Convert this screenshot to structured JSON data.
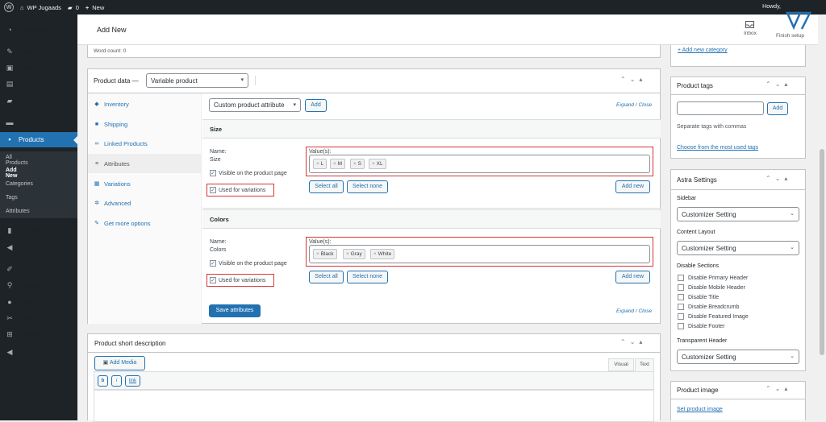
{
  "adminbar": {
    "site_name": "WP Jugaads",
    "comments_count": "0",
    "new_label": "New",
    "howdy": "Howdy,"
  },
  "sidebar": {
    "items": [
      {
        "label": "Dashboard",
        "icon": "dashboard-icon",
        "glyph": "◔"
      },
      {
        "label": "Posts",
        "icon": "pin-icon",
        "glyph": "✎"
      },
      {
        "label": "Media",
        "icon": "media-icon",
        "glyph": "▣"
      },
      {
        "label": "Pages",
        "icon": "pages-icon",
        "glyph": "▤"
      },
      {
        "label": "Comments",
        "icon": "comments-icon",
        "glyph": "▰"
      },
      {
        "label": "WooCommerce",
        "icon": "woo-icon",
        "glyph": "▬"
      },
      {
        "label": "Products",
        "icon": "products-icon",
        "glyph": "▪"
      },
      {
        "label": "Analytics",
        "icon": "analytics-icon",
        "glyph": "▮"
      },
      {
        "label": "Marketing",
        "icon": "marketing-icon",
        "glyph": "◀"
      },
      {
        "label": "Appearance",
        "icon": "brush-icon",
        "glyph": "✐"
      },
      {
        "label": "Plugins",
        "icon": "plugin-icon",
        "glyph": "⚲"
      },
      {
        "label": "Users",
        "icon": "users-icon",
        "glyph": "●"
      },
      {
        "label": "Tools",
        "icon": "wrench-icon",
        "glyph": "✂"
      },
      {
        "label": "Settings",
        "icon": "settings-icon",
        "glyph": "⊞"
      },
      {
        "label": "Collapse menu",
        "icon": "collapse-icon",
        "glyph": "◀"
      }
    ],
    "submenu": [
      "All Products",
      "Add New",
      "Categories",
      "Tags",
      "Attributes"
    ]
  },
  "header": {
    "title": "Add New",
    "inbox": "Inbox",
    "finish_setup": "Finish setup"
  },
  "editor": {
    "word_count": "Word count: 0"
  },
  "product_data": {
    "title": "Product data —",
    "type": "Variable product",
    "tabs": [
      {
        "label": "Inventory",
        "icon": "inventory-icon",
        "glyph": "◆"
      },
      {
        "label": "Shipping",
        "icon": "truck-icon",
        "glyph": "■"
      },
      {
        "label": "Linked Products",
        "icon": "link-icon",
        "glyph": "∞"
      },
      {
        "label": "Attributes",
        "icon": "list-icon",
        "glyph": "≡"
      },
      {
        "label": "Variations",
        "icon": "grid-icon",
        "glyph": "▦"
      },
      {
        "label": "Advanced",
        "icon": "gear-icon",
        "glyph": "✲"
      },
      {
        "label": "Get more options",
        "icon": "plugin-icon",
        "glyph": "✎"
      }
    ],
    "attr_select": "Custom product attribute",
    "add": "Add",
    "expand": "Expand",
    "close": "Close",
    "slash": " / ",
    "attributes": [
      {
        "heading": "Size",
        "name_label": "Name:",
        "name": "Size",
        "values_label": "Value(s):",
        "values": [
          "L",
          "M",
          "S",
          "XL"
        ],
        "visible_label": "Visible on the product page",
        "variations_label": "Used for variations",
        "select_all": "Select all",
        "select_none": "Select none",
        "add_new": "Add new"
      },
      {
        "heading": "Colors",
        "name_label": "Name:",
        "name": "Colors",
        "values_label": "Value(s):",
        "values": [
          "Black",
          "Gray",
          "White"
        ],
        "visible_label": "Visible on the product page",
        "variations_label": "Used for variations",
        "select_all": "Select all",
        "select_none": "Select none",
        "add_new": "Add new"
      }
    ],
    "save": "Save attributes"
  },
  "short_desc": {
    "title": "Product short description",
    "add_media": "Add Media",
    "visual": "Visual",
    "text": "Text",
    "quicktags": [
      "b",
      "i",
      "link"
    ]
  },
  "right": {
    "add_category": "+ Add new category",
    "tags": {
      "title": "Product tags",
      "add": "Add",
      "hint": "Separate tags with commas",
      "most_used": "Choose from the most used tags"
    },
    "astra": {
      "title": "Astra Settings",
      "sidebar_label": "Sidebar",
      "sidebar_value": "Customizer Setting",
      "layout_label": "Content Layout",
      "layout_value": "Customizer Setting",
      "disable_label": "Disable Sections",
      "disable_items": [
        "Disable Primary Header",
        "Disable Mobile Header",
        "Disable Title",
        "Disable Breadcrumb",
        "Disable Featured Image",
        "Disable Footer"
      ],
      "transparent_label": "Transparent Header",
      "transparent_value": "Customizer Setting"
    },
    "image": {
      "title": "Product image",
      "set": "Set product image"
    }
  },
  "colors": {
    "accent": "#2271b1",
    "admin_dark": "#1d2327",
    "highlight": "#d63638"
  }
}
